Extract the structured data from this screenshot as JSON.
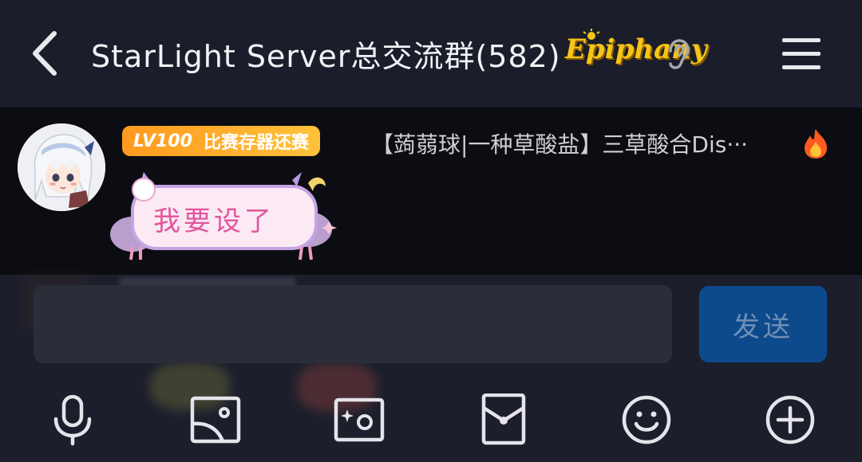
{
  "header": {
    "title": "StarLight Server总交流群(582)",
    "badge_logo": "Epiphany",
    "icons": [
      "back-arrow-icon",
      "ear-icon",
      "menu-icon"
    ]
  },
  "pinned_message": {
    "level": "LV100",
    "title_tag": "比赛存器还赛",
    "text": "【蒟蒻球|一种草酸盐】三草酸合Dis···",
    "sticker_text": "我要设了"
  },
  "composer": {
    "input_value": "",
    "send_label": "发送"
  },
  "toolbar": {
    "items": [
      "microphone-icon",
      "image-icon",
      "camera-icon",
      "red-packet-icon",
      "emoji-icon",
      "plus-icon"
    ]
  },
  "colors": {
    "header_bg": "#1b1e2a",
    "pinned_bg": "#0c0d12",
    "level_badge": "#ff9a1f",
    "send_button": "#0d4a8c",
    "logo_yellow": "#f5c518"
  }
}
